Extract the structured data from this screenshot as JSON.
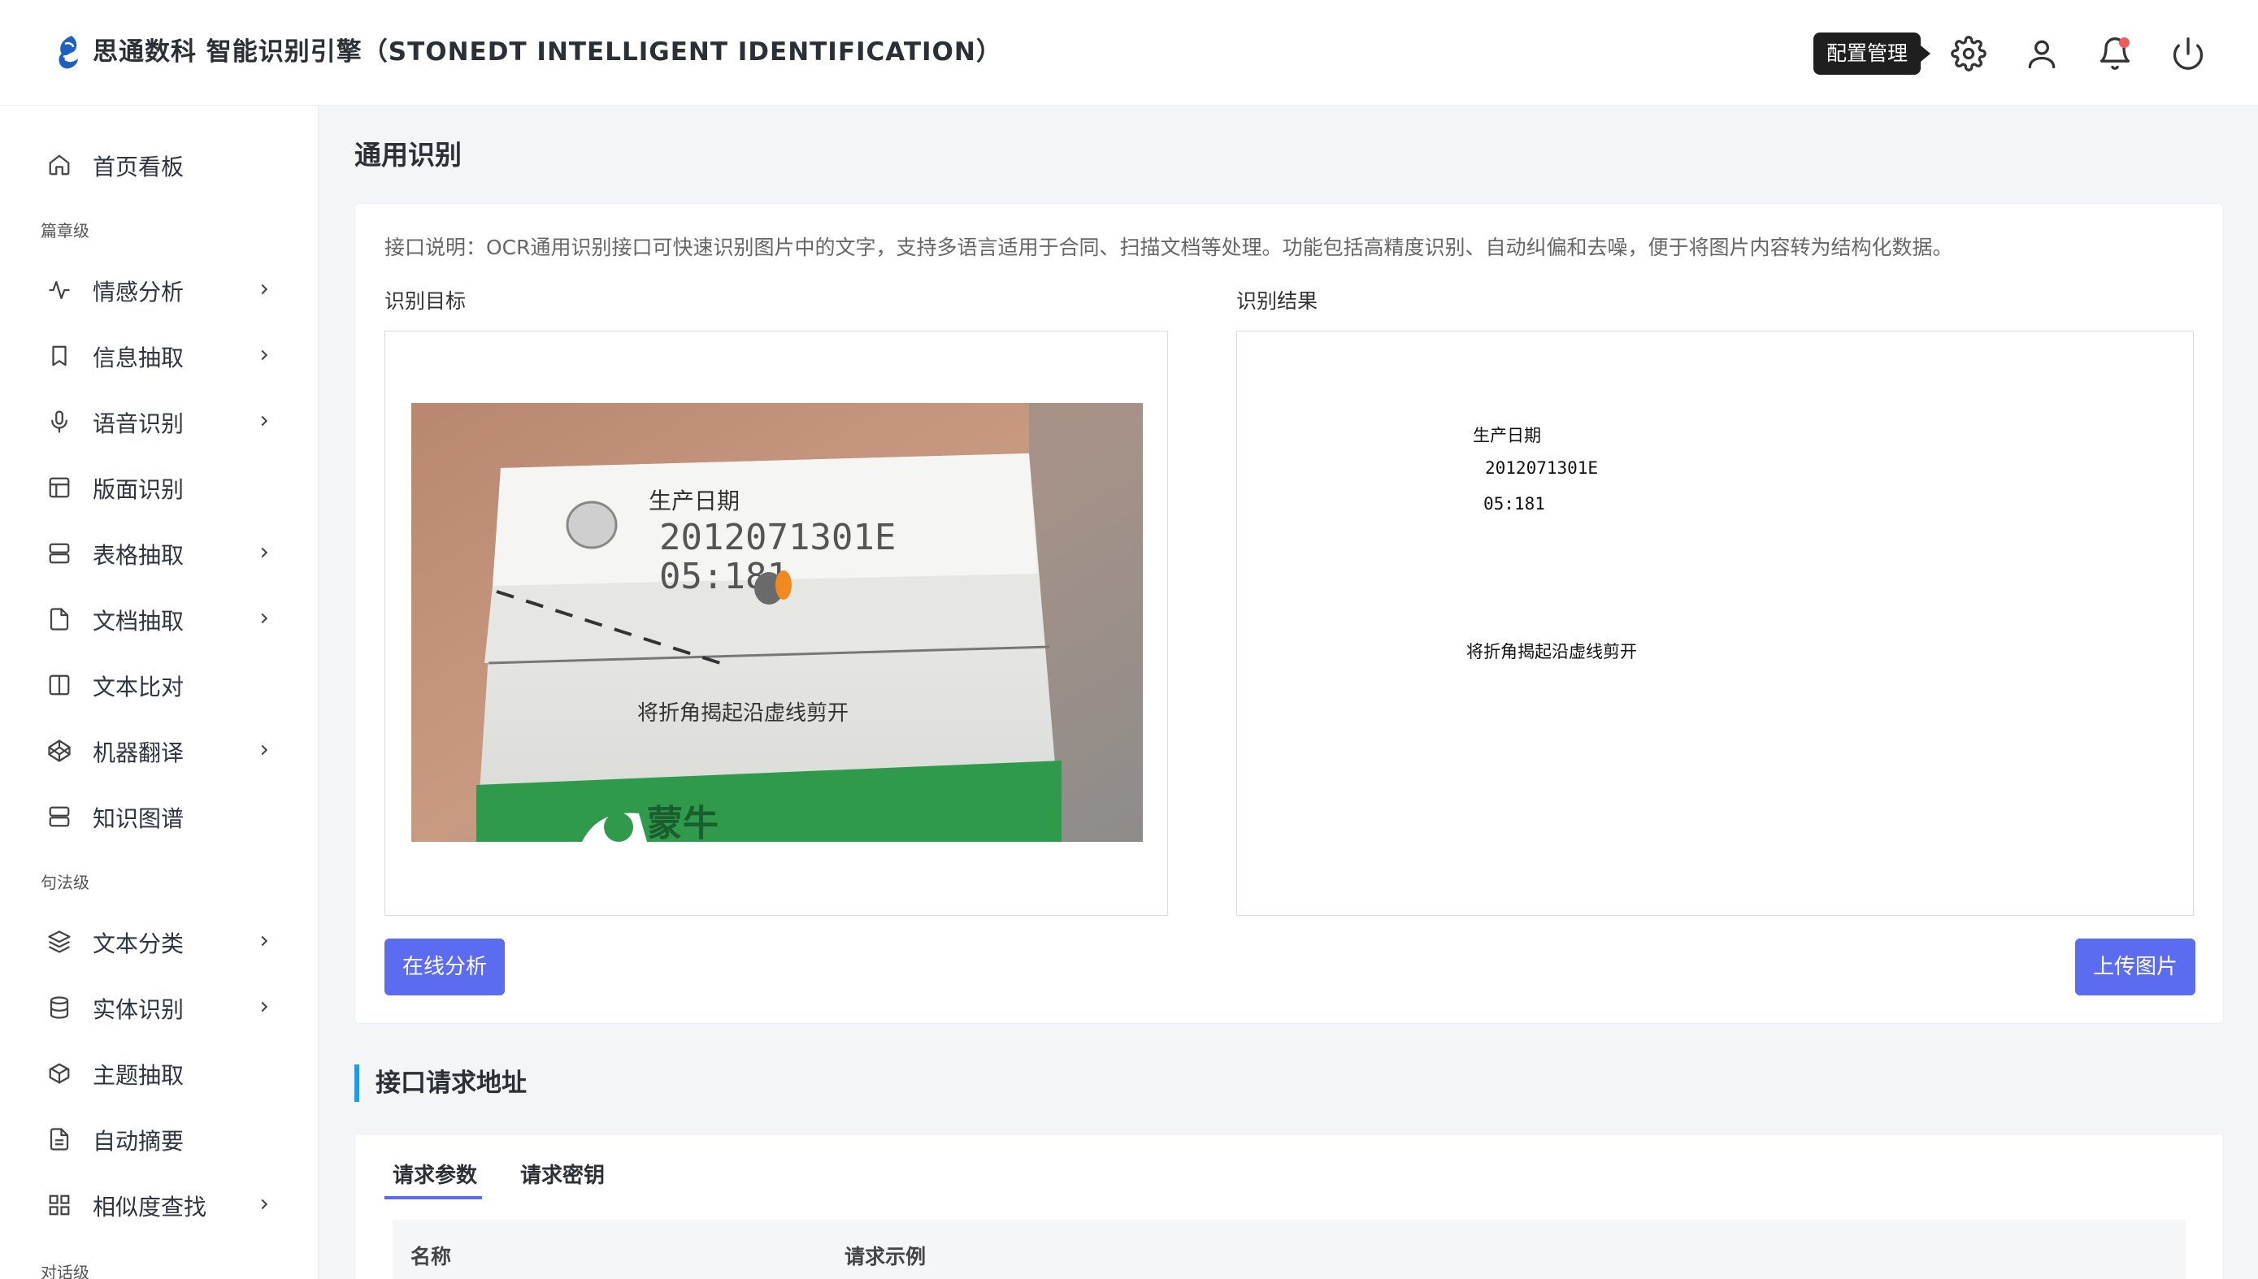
{
  "header": {
    "title": "思通数科 智能识别引擎（STONEDT INTELLIGENT IDENTIFICATION）",
    "tooltip": "配置管理",
    "icons": [
      "gear-icon",
      "user-icon",
      "bell-icon",
      "power-icon"
    ],
    "brand_color": "#1e5fbf"
  },
  "sidebar": {
    "items": [
      {
        "label": "首页看板",
        "icon": "home-icon",
        "has_children": false
      },
      {
        "section": "篇章级"
      },
      {
        "label": "情感分析",
        "icon": "pulse-icon",
        "has_children": true
      },
      {
        "label": "信息抽取",
        "icon": "bookmark-icon",
        "has_children": true
      },
      {
        "label": "语音识别",
        "icon": "microphone-icon",
        "has_children": true
      },
      {
        "label": "版面识别",
        "icon": "layout-icon",
        "has_children": false
      },
      {
        "label": "表格抽取",
        "icon": "server-icon",
        "has_children": true
      },
      {
        "label": "文档抽取",
        "icon": "file-icon",
        "has_children": true
      },
      {
        "label": "文本比对",
        "icon": "columns-icon",
        "has_children": false
      },
      {
        "label": "机器翻译",
        "icon": "codepen-icon",
        "has_children": true
      },
      {
        "label": "知识图谱",
        "icon": "server-icon",
        "has_children": false
      },
      {
        "section": "句法级"
      },
      {
        "label": "文本分类",
        "icon": "layers-icon",
        "has_children": true
      },
      {
        "label": "实体识别",
        "icon": "database-icon",
        "has_children": true
      },
      {
        "label": "主题抽取",
        "icon": "box-icon",
        "has_children": false
      },
      {
        "label": "自动摘要",
        "icon": "file-text-icon",
        "has_children": false
      },
      {
        "label": "相似度查找",
        "icon": "grid-icon",
        "has_children": true
      },
      {
        "section": "对话级"
      }
    ]
  },
  "main": {
    "page_title": "通用识别",
    "description": "接口说明：OCR通用识别接口可快速识别图片中的文字，支持多语言适用于合同、扫描文档等处理。功能包括高精度识别、自动纠偏和去噪，便于将图片内容转为结构化数据。",
    "target_label": "识别目标",
    "result_label": "识别结果",
    "photo_text": {
      "heading": "生产日期",
      "code": "2012071301E",
      "time": "05:181",
      "instruction": "将折角揭起沿虚线剪开"
    },
    "result_lines": [
      "生产日期",
      "2012071301E",
      "05:181",
      "将折角揭起沿虚线剪开"
    ],
    "analyze_button": "在线分析",
    "upload_button": "上传图片",
    "accent_color": "#5b6cf1"
  },
  "api_section": {
    "title": "接口请求地址",
    "tabs": [
      "请求参数",
      "请求密钥"
    ],
    "active_tab": "请求参数",
    "columns": [
      "名称",
      "请求示例"
    ]
  }
}
